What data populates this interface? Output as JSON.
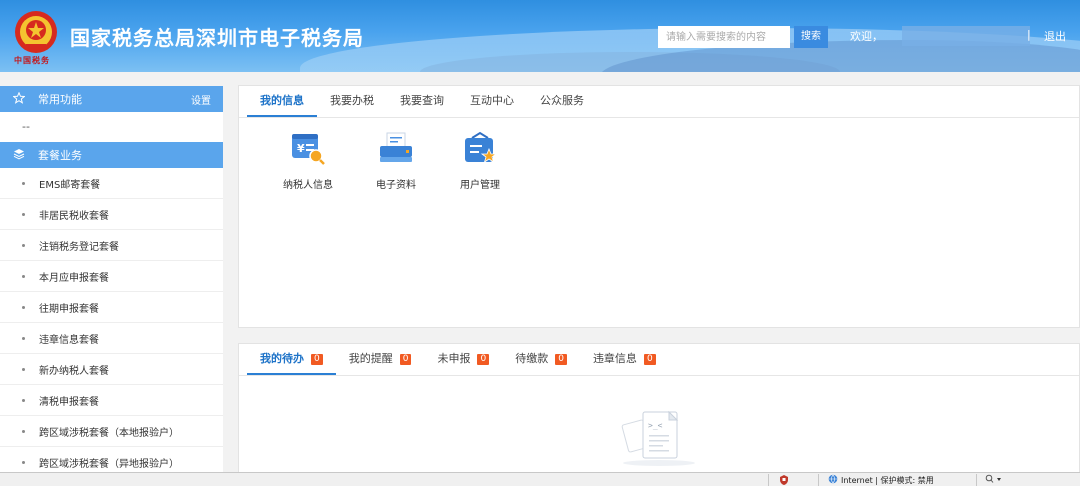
{
  "header": {
    "site_title": "国家税务总局深圳市电子税务局",
    "emblem_text": "中国税务",
    "search_placeholder": "请输入需要搜索的内容",
    "search_button": "搜索",
    "welcome": "欢迎，",
    "separator": "|",
    "logout": "退出"
  },
  "sidebar": {
    "common": {
      "label": "常用功能",
      "setting": "设置",
      "empty": "--"
    },
    "package": {
      "label": "套餐业务",
      "items": [
        "EMS邮寄套餐",
        "非居民税收套餐",
        "注销税务登记套餐",
        "本月应申报套餐",
        "往期申报套餐",
        "违章信息套餐",
        "新办纳税人套餐",
        "清税申报套餐",
        "跨区域涉税套餐（本地报验户）",
        "跨区域涉税套餐（异地报验户）"
      ]
    }
  },
  "main": {
    "tabs": [
      "我的信息",
      "我要办税",
      "我要查询",
      "互动中心",
      "公众服务"
    ],
    "apps": [
      {
        "label": "纳税人信息",
        "icon": "taxpayer-info-icon"
      },
      {
        "label": "电子资料",
        "icon": "electronic-data-icon"
      },
      {
        "label": "用户管理",
        "icon": "user-management-icon"
      }
    ],
    "todo_tabs": [
      {
        "label": "我的待办",
        "count": "0"
      },
      {
        "label": "我的提醒",
        "count": "0"
      },
      {
        "label": "未申报",
        "count": "0"
      },
      {
        "label": "待缴款",
        "count": "0"
      },
      {
        "label": "违章信息",
        "count": "0"
      }
    ]
  },
  "statusbar": {
    "zone": "Internet | 保护模式: 禁用"
  },
  "colors": {
    "accent": "#2b7fd4",
    "sidebar_head": "#5aa5ec",
    "badge": "#f15a22"
  }
}
